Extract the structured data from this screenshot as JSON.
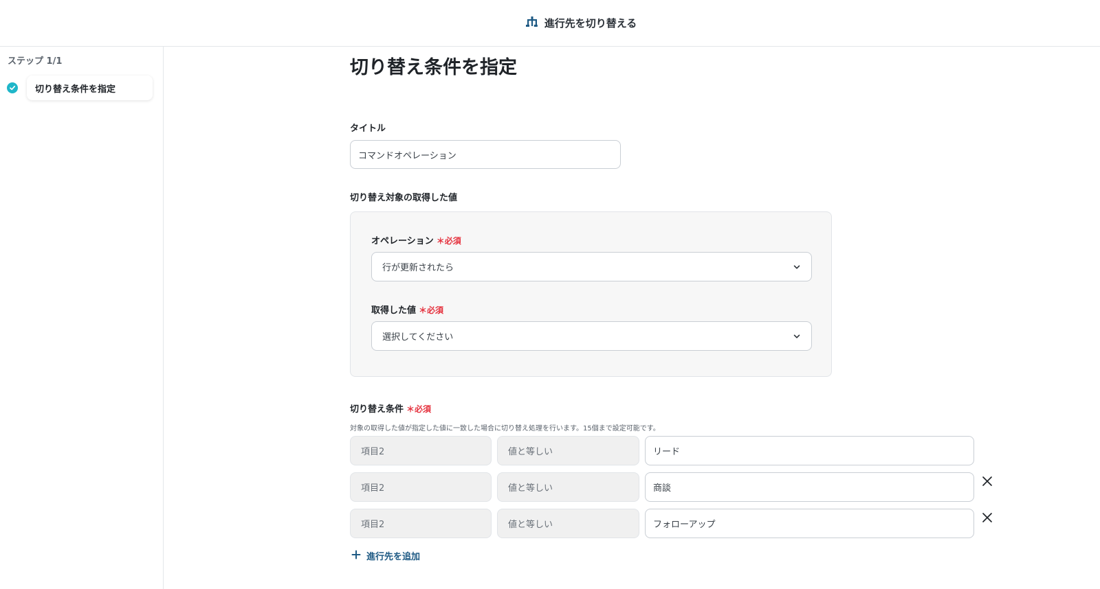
{
  "header": {
    "title": "進行先を切り替える",
    "icon": "branch-icon"
  },
  "sidebar": {
    "step_label": "ステップ 1/1",
    "steps": [
      {
        "label": "切り替え条件を指定",
        "status": "complete"
      }
    ]
  },
  "main": {
    "page_title": "切り替え条件を指定",
    "title_field": {
      "label": "タイトル",
      "value": "コマンドオペレーション"
    },
    "target_section": {
      "label": "切り替え対象の取得した値",
      "operation": {
        "label": "オペレーション",
        "required": "＊必須",
        "value": "行が更新されたら"
      },
      "acquired_value": {
        "label": "取得した値",
        "required": "＊必須",
        "value": "選択してください"
      }
    },
    "conditions": {
      "label": "切り替え条件",
      "required": "＊必須",
      "help": "対象の取得した値が指定した値に一致した場合に切り替え処理を行います。15個まで設定可能です。",
      "rows": [
        {
          "field": "項目2",
          "operator": "値と等しい",
          "value": "リード"
        },
        {
          "field": "項目2",
          "operator": "値と等しい",
          "value": "商談"
        },
        {
          "field": "項目2",
          "operator": "値と等しい",
          "value": "フォローアップ"
        }
      ]
    },
    "add_label": "進行先を追加"
  },
  "colors": {
    "accent": "#1fb6c9",
    "link": "#1e5a84",
    "required": "#e5323e"
  }
}
